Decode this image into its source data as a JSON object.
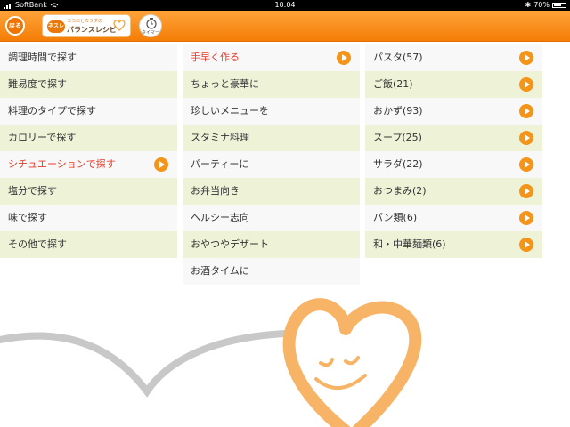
{
  "status_bar": {
    "carrier": "SoftBank",
    "time": "10:04",
    "battery": "70%",
    "battery_level": 0.7
  },
  "header": {
    "back_label": "戻る",
    "logo_brand": "ネスレ",
    "logo_sub": "ココロとカラダの",
    "logo_title": "バランスレシピ",
    "timer_label": "タイマー"
  },
  "categories": [
    {
      "label": "調理時間で探す"
    },
    {
      "label": "難易度で探す"
    },
    {
      "label": "料理のタイプで探す"
    },
    {
      "label": "カロリーで探す"
    },
    {
      "label": "シチュエーションで探す",
      "selected": true
    },
    {
      "label": "塩分で探す"
    },
    {
      "label": "味で探す"
    },
    {
      "label": "その他で探す"
    }
  ],
  "situations": [
    {
      "label": "手早く作る",
      "selected": true
    },
    {
      "label": "ちょっと豪華に"
    },
    {
      "label": "珍しいメニューを"
    },
    {
      "label": "スタミナ料理"
    },
    {
      "label": "パーティーに"
    },
    {
      "label": "お弁当向き"
    },
    {
      "label": "ヘルシー志向"
    },
    {
      "label": "おやつやデザート"
    },
    {
      "label": "お酒タイムに"
    }
  ],
  "recipe_types": [
    {
      "label": "パスタ(57)"
    },
    {
      "label": "ご飯(21)"
    },
    {
      "label": "おかず(93)"
    },
    {
      "label": "スープ(25)"
    },
    {
      "label": "サラダ(22)"
    },
    {
      "label": "おつまみ(2)"
    },
    {
      "label": "パン類(6)"
    },
    {
      "label": "和・中華麺類(6)"
    }
  ],
  "colors": {
    "header": "#f47d06",
    "accent": "#f49418",
    "selected_text": "#e8392a",
    "row_alt": "#eef3d8"
  }
}
